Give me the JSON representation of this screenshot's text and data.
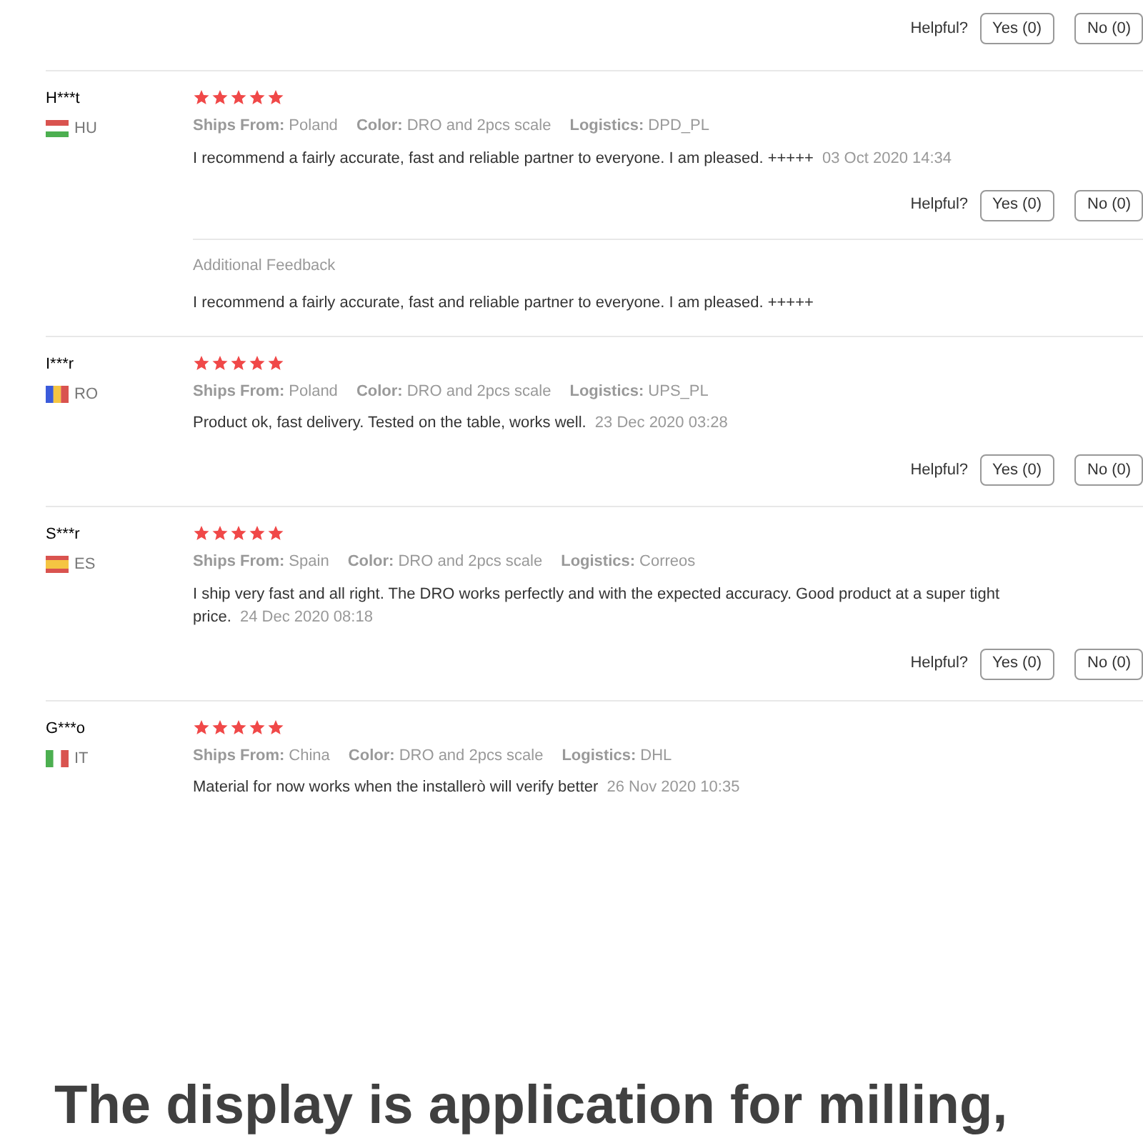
{
  "top_helpful": {
    "label": "Helpful?",
    "yes": "Yes (0)",
    "no": "No (0)"
  },
  "reviews": [
    {
      "name": "H***t",
      "country": "HU",
      "flag": {
        "kind": "hungary"
      },
      "stars": 5,
      "meta": [
        {
          "label": "Ships From:",
          "value": "Poland"
        },
        {
          "label": "Color:",
          "value": "DRO and 2pcs scale"
        },
        {
          "label": "Logistics:",
          "value": "DPD_PL"
        }
      ],
      "text": "I recommend a fairly accurate, fast and reliable partner to everyone. I am pleased. +++++",
      "date": "03 Oct 2020 14:34",
      "helpful": {
        "label": "Helpful?",
        "yes": "Yes (0)",
        "no": "No (0)"
      },
      "additional": {
        "title": "Additional Feedback",
        "text": "I recommend a fairly accurate, fast and reliable partner to everyone. I am pleased. +++++"
      }
    },
    {
      "name": "I***r",
      "country": "RO",
      "flag": {
        "kind": "romania"
      },
      "stars": 5,
      "meta": [
        {
          "label": "Ships From:",
          "value": "Poland"
        },
        {
          "label": "Color:",
          "value": "DRO and 2pcs scale"
        },
        {
          "label": "Logistics:",
          "value": "UPS_PL"
        }
      ],
      "text": "Product ok, fast delivery. Tested on the table, works well.",
      "date": "23 Dec 2020 03:28",
      "helpful": {
        "label": "Helpful?",
        "yes": "Yes (0)",
        "no": "No (0)"
      }
    },
    {
      "name": "S***r",
      "country": "ES",
      "flag": {
        "kind": "spain"
      },
      "stars": 5,
      "meta": [
        {
          "label": "Ships From:",
          "value": "Spain"
        },
        {
          "label": "Color:",
          "value": "DRO and 2pcs scale"
        },
        {
          "label": "Logistics:",
          "value": "Correos"
        }
      ],
      "text": "I ship very fast and all right. The DRO works perfectly and with the expected accuracy. Good product at a super tight price.",
      "date": "24 Dec 2020 08:18",
      "helpful": {
        "label": "Helpful?",
        "yes": "Yes (0)",
        "no": "No (0)"
      }
    },
    {
      "name": "G***o",
      "country": "IT",
      "flag": {
        "kind": "italy"
      },
      "stars": 5,
      "meta": [
        {
          "label": "Ships From:",
          "value": "China"
        },
        {
          "label": "Color:",
          "value": "DRO and 2pcs scale"
        },
        {
          "label": "Logistics:",
          "value": "DHL"
        }
      ],
      "text": "Material for now works when the installerò will verify better",
      "date": "26 Nov 2020 10:35"
    }
  ],
  "heading": "The display is application for milling,"
}
